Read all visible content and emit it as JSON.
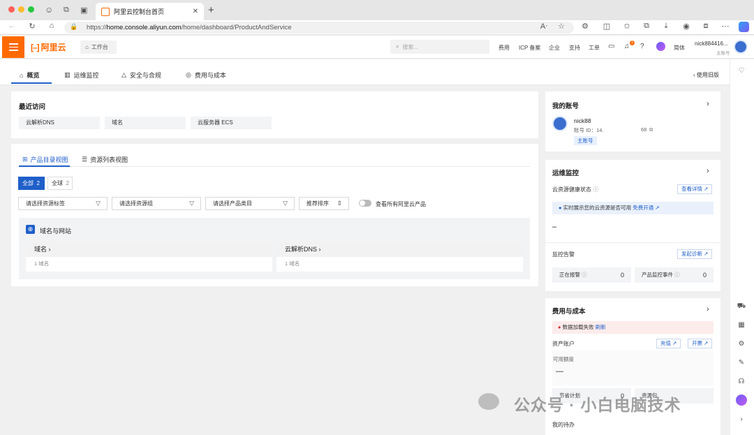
{
  "browser": {
    "tab_title": "阿里云控制台首页",
    "url_prefix": "https://",
    "url_host": "home.console.aliyun.com",
    "url_path": "/home/dashboard/ProductAndService"
  },
  "header": {
    "logo": "阿里云",
    "workbench": "工作台",
    "search_placeholder": "搜索...",
    "nav": [
      "费用",
      "ICP 备案",
      "企业",
      "支持",
      "工单"
    ],
    "lang": "简体",
    "notification_count": "1",
    "account_name": "nick884416...",
    "account_sub": "主账号"
  },
  "tabs": [
    {
      "label": "概览",
      "icon": "home-icon"
    },
    {
      "label": "运维监控",
      "icon": "monitor-icon"
    },
    {
      "label": "安全与合规",
      "icon": "warning-icon"
    },
    {
      "label": "费用与成本",
      "icon": "cost-icon"
    }
  ],
  "old_version": "使用旧版",
  "recent": {
    "title": "最近访问",
    "items": [
      "云解析DNS",
      "域名",
      "云服务器 ECS"
    ]
  },
  "products": {
    "view_tabs": [
      "产品目录视图",
      "资源列表视图"
    ],
    "scope_all": "全部",
    "scope_all_count": "2",
    "scope_global": "全球",
    "scope_global_count": "2",
    "filters": [
      "请选择资源标签",
      "请选择资源组",
      "请选择产品类目",
      "推荐排序"
    ],
    "toggle_label": "查看所有阿里云产品",
    "group_title": "域名与网站",
    "cards": [
      {
        "name": "域名",
        "count": "1 域名"
      },
      {
        "name": "云解析DNS",
        "count": "1 域名"
      }
    ]
  },
  "account": {
    "title": "我的账号",
    "name": "nick88",
    "id_label": "账号 ID：14.",
    "id_tail": "68",
    "badge": "主账号"
  },
  "ops": {
    "title": "运维监控",
    "health_label": "云资源健康状态",
    "details_btn": "查看详情",
    "info_text": "实时展示您的云资源是否可用",
    "info_link": "免费开通",
    "dash": "–",
    "alarm_label": "监控告警",
    "diagnose_btn": "发起诊断",
    "alarming_label": "正在报警",
    "alarming_value": "0",
    "events_label": "产品监控事件",
    "events_value": "0"
  },
  "cost": {
    "title": "费用与成本",
    "error_text": "数据加载失败",
    "refresh": "刷新",
    "asset_label": "资产账户",
    "recharge_btn": "充值",
    "invoice_btn": "开票",
    "available_label": "可用额度",
    "dash": "—",
    "saving_label": "节省计划",
    "saving_value": "0",
    "resource_pack_label": "资源包",
    "todo_label": "我的待办"
  },
  "watermark": "公众号 · 小白电脑技术"
}
